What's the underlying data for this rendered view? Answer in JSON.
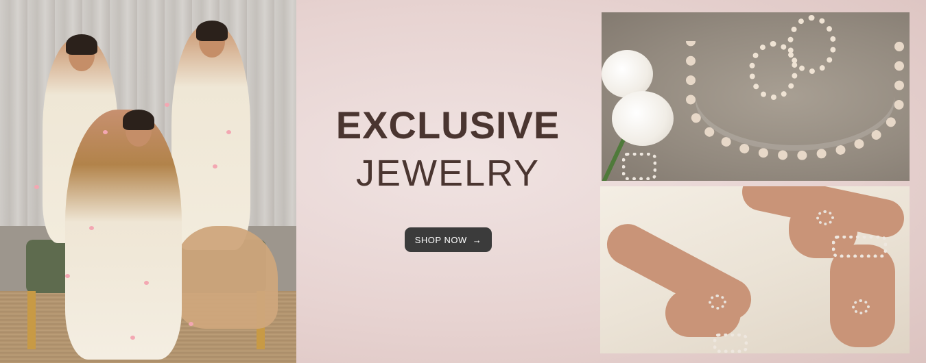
{
  "banner": {
    "headline_line1": "EXCLUSIVE",
    "headline_line2": "JEWELRY",
    "cta_label": "SHOP NOW",
    "cta_icon": "arrow-right-icon",
    "colors": {
      "background": "#e9d8d6",
      "headline": "#4a3530",
      "button_bg": "#3b3b3b",
      "button_text": "#ffffff"
    }
  }
}
